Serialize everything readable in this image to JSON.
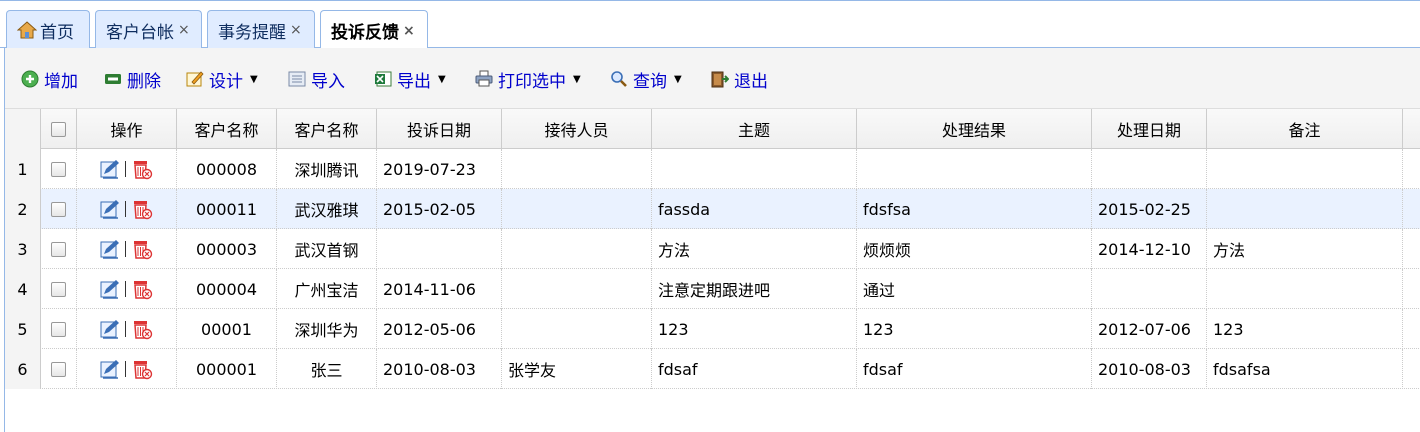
{
  "tabs": [
    {
      "label": "首页",
      "icon": "home-icon",
      "closable": false,
      "active": false
    },
    {
      "label": "客户台帐",
      "closable": true,
      "active": false
    },
    {
      "label": "事务提醒",
      "closable": true,
      "active": false
    },
    {
      "label": "投诉反馈",
      "closable": true,
      "active": true
    }
  ],
  "tab_close_glyph": "×",
  "toolbar": {
    "add": "增加",
    "delete": "删除",
    "design": "设计",
    "import": "导入",
    "export": "导出",
    "print": "打印选中",
    "query": "查询",
    "exit": "退出"
  },
  "columns": [
    "操作",
    "客户名称",
    "客户名称",
    "投诉日期",
    "接待人员",
    "主题",
    "处理结果",
    "处理日期",
    "备注"
  ],
  "rows": [
    {
      "n": "1",
      "code": "000008",
      "name": "深圳腾讯",
      "date": "2019-07-23",
      "staff": "",
      "subject": "",
      "result": "",
      "pdate": "",
      "note": ""
    },
    {
      "n": "2",
      "code": "000011",
      "name": "武汉雅琪",
      "date": "2015-02-05",
      "staff": "",
      "subject": "fassda",
      "result": "fdsfsa",
      "pdate": "2015-02-25",
      "note": ""
    },
    {
      "n": "3",
      "code": "000003",
      "name": "武汉首钢",
      "date": "",
      "staff": "",
      "subject": "方法",
      "result": "烦烦烦",
      "pdate": "2014-12-10",
      "note": "方法"
    },
    {
      "n": "4",
      "code": "000004",
      "name": "广州宝洁",
      "date": "2014-11-06",
      "staff": "",
      "subject": "注意定期跟进吧",
      "result": "通过",
      "pdate": "",
      "note": ""
    },
    {
      "n": "5",
      "code": "00001",
      "name": "深圳华为",
      "date": "2012-05-06",
      "staff": "",
      "subject": "123",
      "result": "123",
      "pdate": "2012-07-06",
      "note": "123"
    },
    {
      "n": "6",
      "code": "000001",
      "name": "张三",
      "date": "2010-08-03",
      "staff": "张学友",
      "subject": "fdsaf",
      "result": "fdsaf",
      "pdate": "2010-08-03",
      "note": "fdsafsa"
    }
  ],
  "selected_row": 2,
  "colors": {
    "accent_border": "#95b8e7",
    "tab_bg": "#e0ecff",
    "link_text": "#0000cc",
    "selected_row": "#eaf2ff"
  }
}
